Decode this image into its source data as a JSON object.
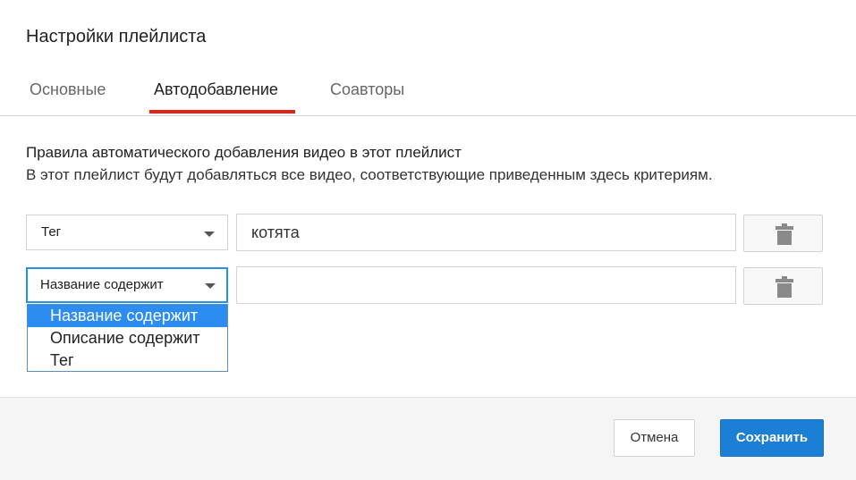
{
  "dialog": {
    "title": "Настройки плейлиста"
  },
  "tabs": [
    {
      "label": "Основные",
      "active": false
    },
    {
      "label": "Автодобавление",
      "active": true
    },
    {
      "label": "Соавторы",
      "active": false
    }
  ],
  "rules": {
    "heading": "Правила автоматического добавления видео в этот плейлист",
    "description": "В этот плейлист будут добавляться все видео, соответствующие приведенным здесь критериям.",
    "rows": [
      {
        "condition": "Тег",
        "value": "котята",
        "delete_icon": "trash-icon"
      },
      {
        "condition": "Название содержит",
        "value": "",
        "delete_icon": "trash-icon"
      }
    ]
  },
  "dropdown": {
    "options": [
      "Название содержит",
      "Описание содержит",
      "Тег"
    ],
    "selected": "Название содержит"
  },
  "footer": {
    "cancel_label": "Отмена",
    "save_label": "Сохранить"
  },
  "colors": {
    "accent_tab": "#e62117",
    "primary_button": "#1c7fd6",
    "dropdown_highlight": "#2d8cf0"
  }
}
